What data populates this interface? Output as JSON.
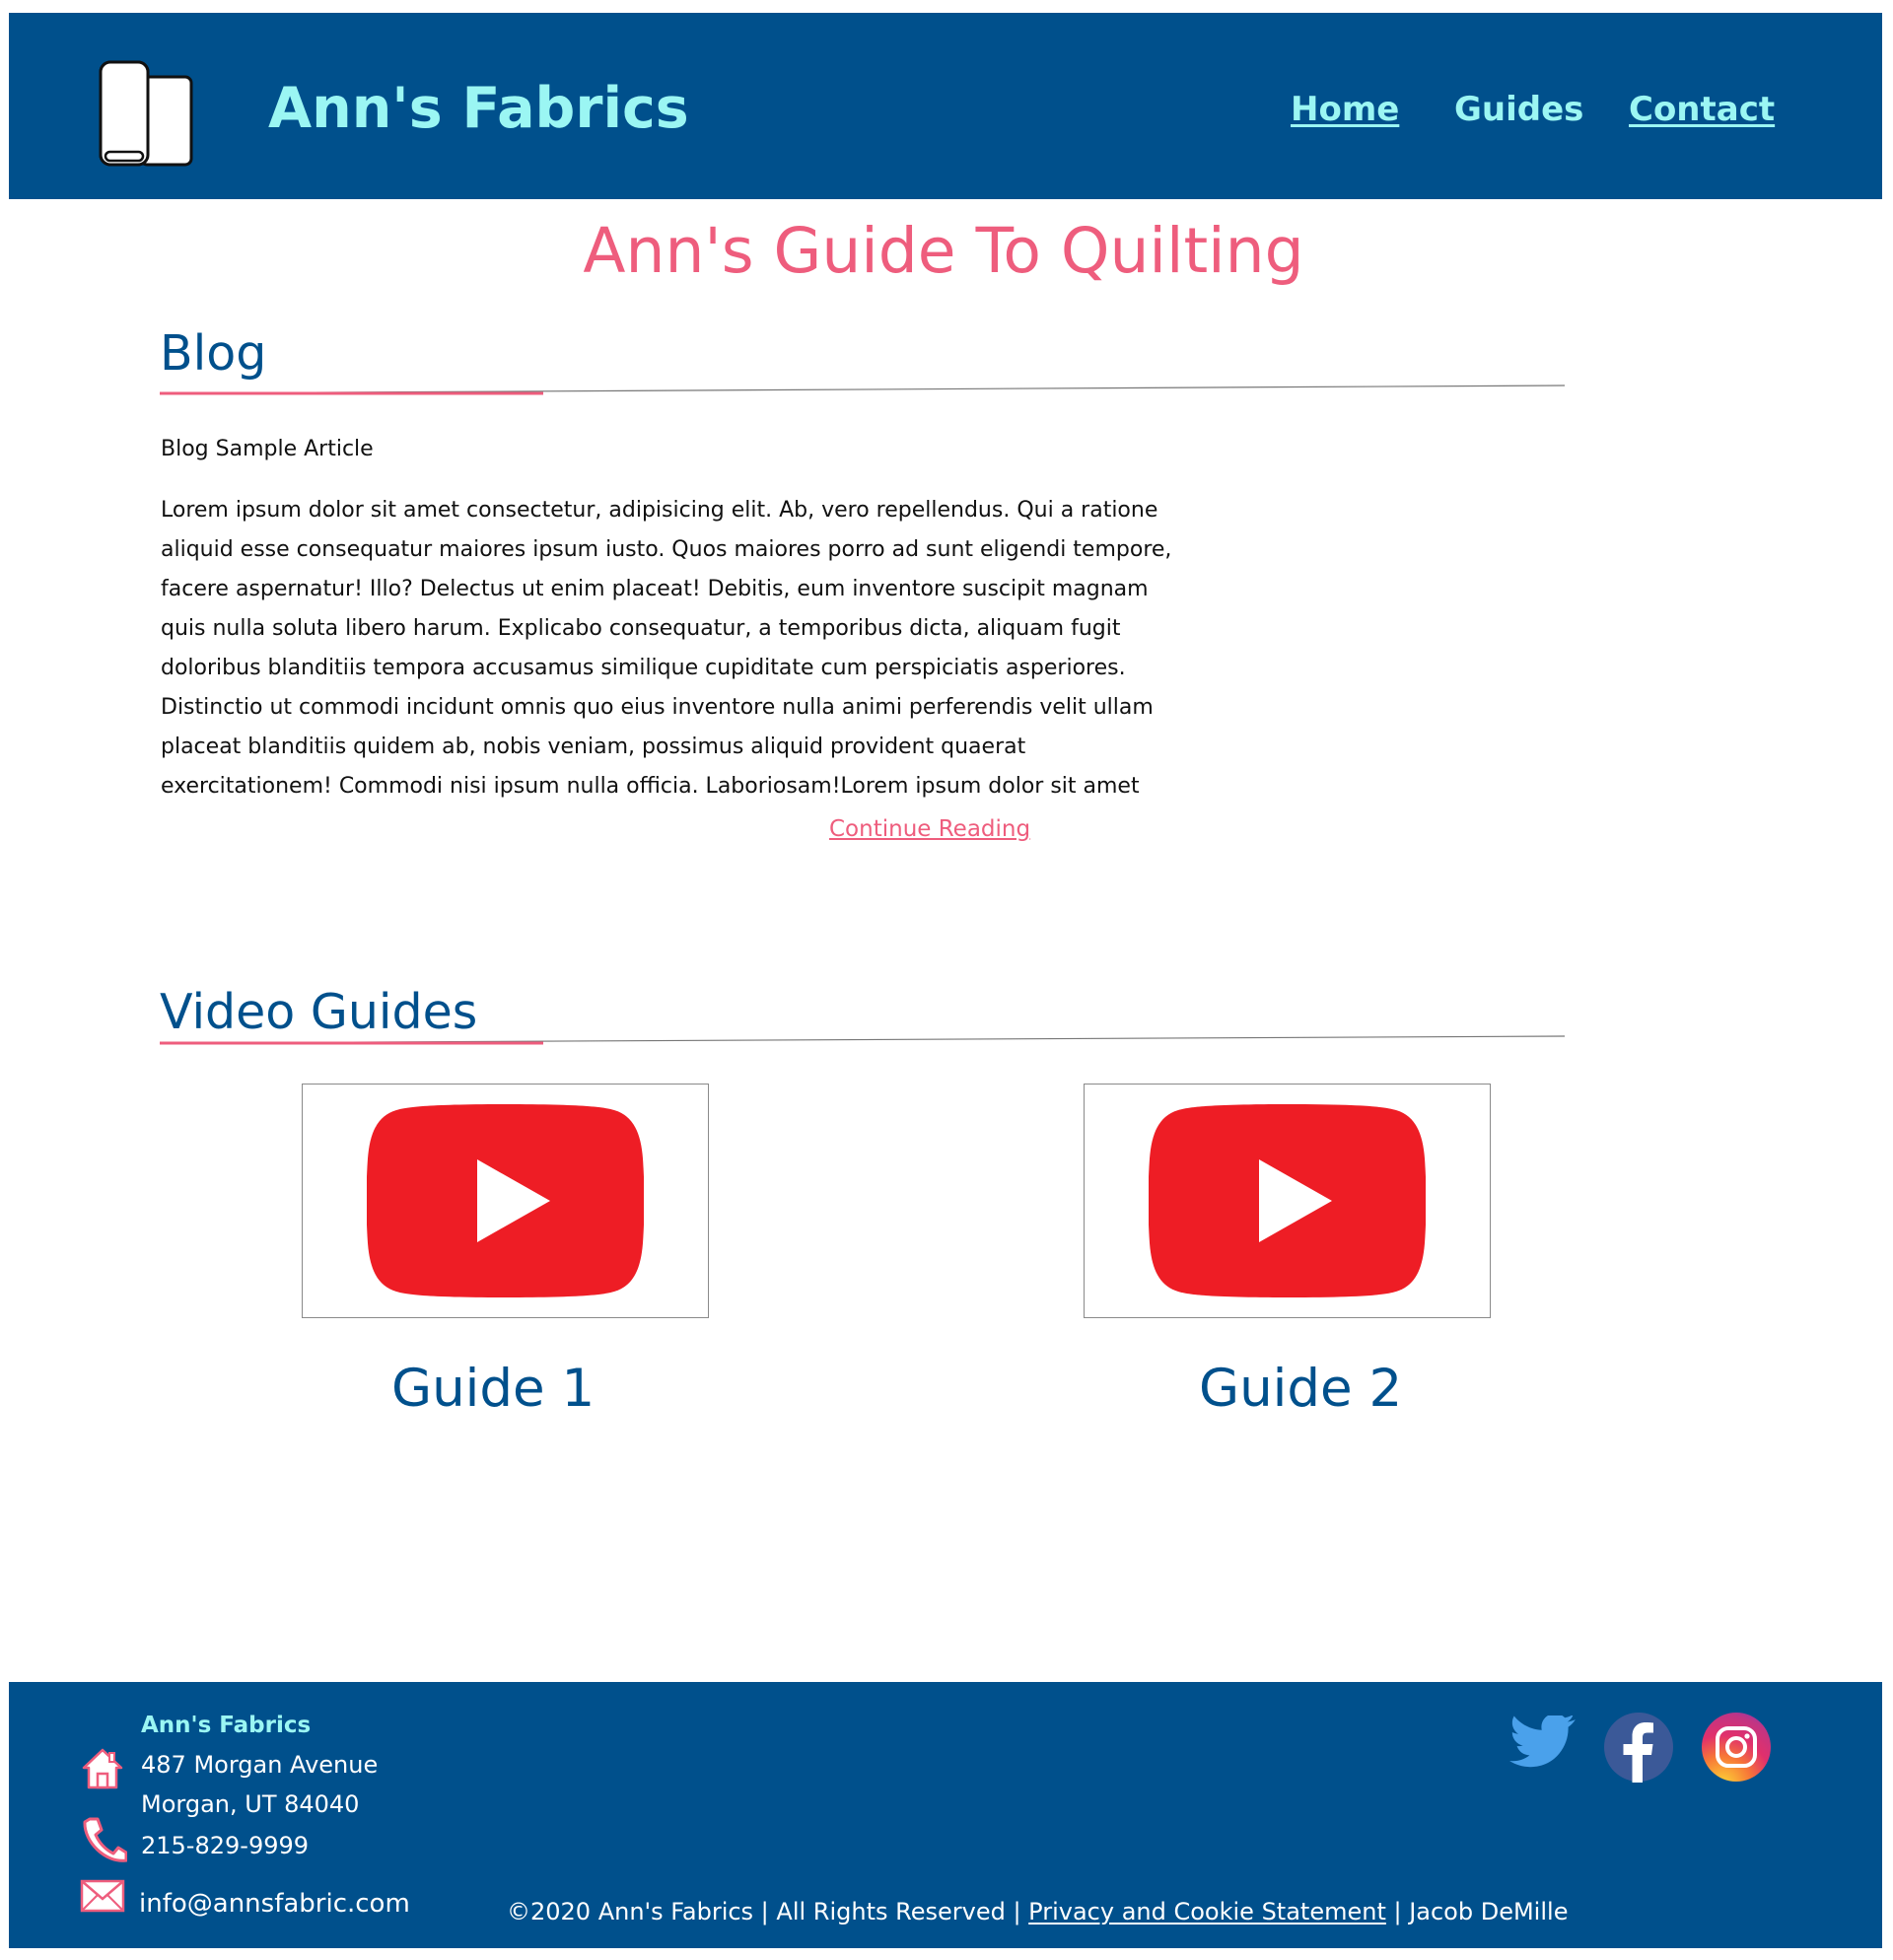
{
  "header": {
    "brand": "Ann's Fabrics",
    "nav": {
      "home": "Home",
      "guides": "Guides",
      "contact": "Contact"
    }
  },
  "page": {
    "title": "Ann's Guide To Quilting"
  },
  "blog": {
    "heading": "Blog",
    "article_title": "Blog Sample Article",
    "body_lines": [
      "Lorem ipsum dolor sit amet consectetur, adipisicing elit. Ab, vero repellendus. Qui a ratione",
      "aliquid esse consequatur maiores ipsum iusto. Quos maiores porro ad sunt eligendi tempore,",
      "facere aspernatur! Illo? Delectus ut enim placeat! Debitis, eum inventore suscipit magnam",
      "quis nulla soluta libero harum. Explicabo consequatur, a temporibus dicta, aliquam fugit",
      "doloribus blanditiis tempora accusamus similique cupiditate cum perspiciatis asperiores.",
      "Distinctio ut commodi incidunt omnis quo eius inventore nulla animi perferendis velit ullam",
      "placeat blanditiis quidem ab, nobis veniam, possimus aliquid provident quaerat",
      "exercitationem! Commodi nisi ipsum nulla officia. Laboriosam!Lorem ipsum dolor sit amet"
    ],
    "continue_label": "Continue Reading"
  },
  "videos": {
    "heading": "Video Guides",
    "items": [
      {
        "title": "Guide 1",
        "icon": "youtube-play-icon"
      },
      {
        "title": "Guide 2",
        "icon": "youtube-play-icon"
      }
    ]
  },
  "footer": {
    "name": "Ann's Fabrics",
    "address_line1": "487 Morgan Avenue",
    "address_line2": "Morgan, UT 84040",
    "phone": "215-829-9999",
    "email": "info@annsfabric.com",
    "copyright_prefix": "©2020 Ann's Fabrics | All Rights Reserved | ",
    "privacy_label": "Privacy and Cookie Statement",
    "copyright_suffix": " | Jacob DeMille",
    "social": [
      "twitter-icon",
      "facebook-icon",
      "instagram-icon"
    ]
  },
  "colors": {
    "header_bg": "#00508c",
    "brand_text": "#9bf6f3",
    "accent_pink": "#ee5d7d",
    "heading_blue": "#00508c",
    "youtube_red": "#ee1d25"
  }
}
